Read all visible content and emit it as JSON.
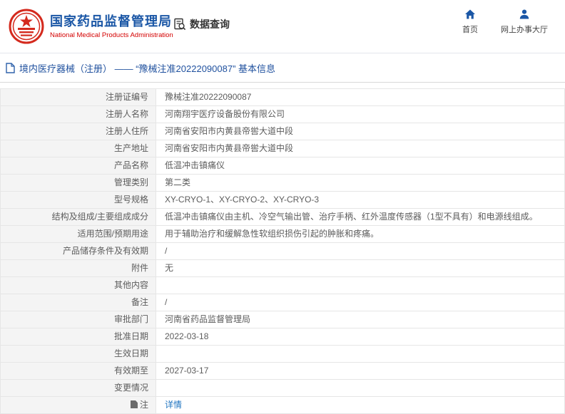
{
  "header": {
    "agency_name_cn": "国家药品监督管理局",
    "agency_name_en": "National Medical Products Administration",
    "nav_data_query": "数据查询",
    "nav_home": "首页",
    "nav_service_hall": "网上办事大厅"
  },
  "breadcrumb": {
    "title": "境内医疗器械（注册） —— “豫械注准20222090087” 基本信息"
  },
  "table": {
    "rows": [
      {
        "label": "注册证编号",
        "value": "豫械注准20222090087"
      },
      {
        "label": "注册人名称",
        "value": "河南翔宇医疗设备股份有限公司"
      },
      {
        "label": "注册人住所",
        "value": "河南省安阳市内黄县帝喾大道中段"
      },
      {
        "label": "生产地址",
        "value": "河南省安阳市内黄县帝喾大道中段"
      },
      {
        "label": "产品名称",
        "value": "低温冲击镇痛仪"
      },
      {
        "label": "管理类别",
        "value": "第二类"
      },
      {
        "label": "型号规格",
        "value": "XY-CRYO-1、XY-CRYO-2、XY-CRYO-3"
      },
      {
        "label": "结构及组成/主要组成成分",
        "value": "低温冲击镇痛仪由主机、冷空气输出管、治疗手柄、红外温度传感器（1型不具有）和电源线组成。"
      },
      {
        "label": "适用范围/预期用途",
        "value": "用于辅助治疗和缓解急性软组织损伤引起的肿胀和疼痛。"
      },
      {
        "label": "产品储存条件及有效期",
        "value": "/"
      },
      {
        "label": "附件",
        "value": "无"
      },
      {
        "label": "其他内容",
        "value": ""
      },
      {
        "label": "备注",
        "value": "/"
      },
      {
        "label": "审批部门",
        "value": "河南省药品监督管理局"
      },
      {
        "label": "批准日期",
        "value": "2022-03-18"
      },
      {
        "label": "生效日期",
        "value": ""
      },
      {
        "label": "有效期至",
        "value": "2027-03-17"
      },
      {
        "label": "变更情况",
        "value": ""
      },
      {
        "label": "注",
        "value": "详情",
        "link": true,
        "label_icon": true
      }
    ]
  },
  "colors": {
    "agency_blue": "#1b57a6",
    "agency_red": "#d40000",
    "link_blue": "#1f74c0",
    "label_bg": "#f4f4f4",
    "border": "#e6e6e6"
  }
}
